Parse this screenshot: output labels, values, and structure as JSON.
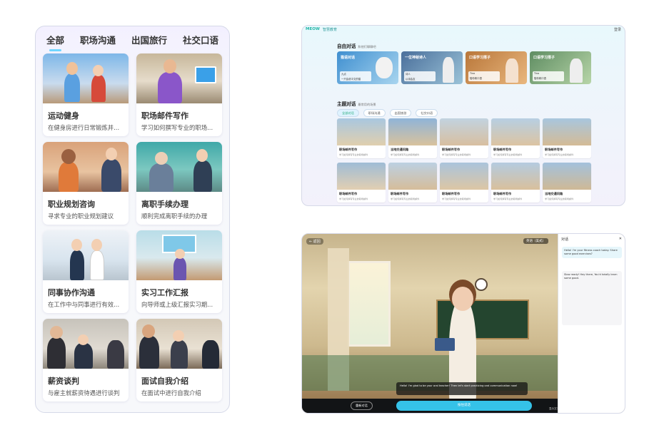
{
  "phone": {
    "tabs": [
      "全部",
      "职场沟通",
      "出国旅行",
      "社交口语"
    ],
    "active_tab_index": 0,
    "cards": [
      {
        "title": "运动健身",
        "desc": "在健身房进行日常锻炼并..."
      },
      {
        "title": "职场邮件写作",
        "desc": "学习如何撰写专业的职场..."
      },
      {
        "title": "职业规划咨询",
        "desc": "寻求专业的职业规划建议"
      },
      {
        "title": "离职手续办理",
        "desc": "顺利完成离职手续的办理"
      },
      {
        "title": "同事协作沟通",
        "desc": "在工作中与同事进行有效..."
      },
      {
        "title": "实习工作汇报",
        "desc": "向导师或上级汇报实习期..."
      },
      {
        "title": "薪资谈判",
        "desc": "与雇主就薪资待遇进行谈判"
      },
      {
        "title": "面试自我介绍",
        "desc": "在面试中进行自我介绍"
      }
    ]
  },
  "desktop": {
    "logo": "MEOW",
    "app_name": "智慧教育",
    "top_right": "登录",
    "free_section": {
      "title": "自由对话",
      "subtitle": "和他们聊聊吧"
    },
    "free_cards": [
      {
        "title": "猫语对话",
        "name": "九点",
        "desc": "一只会说中文的猫"
      },
      {
        "title": "一位神秘诗人",
        "name": "诗人",
        "desc": "以诗会友"
      },
      {
        "title": "口语学习搭子",
        "name": "Tina",
        "desc": "陪你练口语"
      },
      {
        "title": "口语学习搭子",
        "name": "Tina",
        "desc": "陪你练口语"
      }
    ],
    "topic_section": {
      "title": "主题对话",
      "subtitle": "最常用的场景"
    },
    "pills": [
      "全部对话",
      "职场沟通",
      "出国旅游",
      "社交口语"
    ],
    "topic_cards": [
      {
        "title": "职场邮件写作",
        "desc": "学习如何撰写专业的职场邮件"
      },
      {
        "title": "当地交通问路",
        "desc": "学习如何撰写专业的职场邮件"
      },
      {
        "title": "职场邮件写作",
        "desc": "学习如何撰写专业的职场邮件"
      },
      {
        "title": "职场邮件写作",
        "desc": "学习如何撰写专业的职场邮件"
      },
      {
        "title": "职场邮件写作",
        "desc": "学习如何撰写专业的职场邮件"
      },
      {
        "title": "职场邮件写作",
        "desc": "学习如何撰写专业的职场邮件"
      },
      {
        "title": "职场邮件写作",
        "desc": "学习如何撰写专业的职场邮件"
      },
      {
        "title": "职场邮件写作",
        "desc": "学习如何撰写专业的职场邮件"
      },
      {
        "title": "职场邮件写作",
        "desc": "学习如何撰写专业的职场邮件"
      },
      {
        "title": "当地交通问路",
        "desc": "学习如何撰写专业的职场邮件"
      }
    ]
  },
  "classroom": {
    "back": "← 返回",
    "language": "英语（美式）",
    "chat_title": "对话",
    "msg1": "Hello! I'm your fitness coach today. Share some good exercises?",
    "msg2": "Slow ready! Hey there, You'd totally learn some good.",
    "subtitle": "Hello! I'm glad to be your oral teacher! Then let's start practicing oral communication now!",
    "left_button": "重新对话",
    "mic_button": "按住说话",
    "right_btn1": "显示文字",
    "right_btn2": "查看字幕"
  },
  "colors": {
    "accent": "#6fd6ff",
    "mic": "#35c2e8"
  }
}
